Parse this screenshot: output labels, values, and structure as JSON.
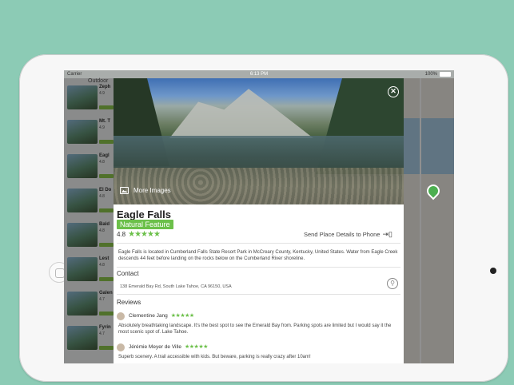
{
  "status_bar": {
    "carrier": "Carrier",
    "time": "6:13 PM",
    "battery": "100%"
  },
  "list": {
    "title": "Outdoor",
    "items": [
      {
        "name": "Zeph",
        "rating": "4.9"
      },
      {
        "name": "Mt. T",
        "rating": "4.9"
      },
      {
        "name": "Eagl",
        "rating": "4.8"
      },
      {
        "name": "El Do",
        "rating": "4.8"
      },
      {
        "name": "Bald",
        "rating": "4.8"
      },
      {
        "name": "Lest",
        "rating": "4.8"
      },
      {
        "name": "Galen",
        "rating": "4.7"
      },
      {
        "name": "Fyrin",
        "rating": "4.7"
      }
    ]
  },
  "detail": {
    "more_images": "More Images",
    "close_icon": "close-icon",
    "name": "Eagle Falls",
    "category": "Natural Feature",
    "rating": "4.8",
    "stars": "★★★★★",
    "send_label": "Send Place Details to Phone",
    "description": "Eagle Falls is located in Cumberland Falls State Resort Park in McCreary County, Kentucky, United States. Water from Eagle Creek descends 44 feet before landing on the rocks below on the Cumberland River shoreline.",
    "contact_title": "Contact",
    "address": "138 Emerald Bay Rd, South Lake Tahoe, CA 96150, USA",
    "reviews_title": "Reviews",
    "reviews": [
      {
        "author": "Clementine Jang",
        "stars": "★★★★★",
        "text": "Absolutely breathtaking landscape. It's the best spot to see the Emerald Bay from. Parking spots are limited but I would say it the most scenic spot of. Lake Tahoe."
      },
      {
        "author": "Jérémie Meyer de Ville",
        "stars": "★★★★★",
        "text": "Superb scenery. A trail accessible with kids. But beware, parking is really crazy after 10am!"
      }
    ]
  },
  "colors": {
    "accent_green": "#6cc04a",
    "background": "#8ccbb5"
  }
}
